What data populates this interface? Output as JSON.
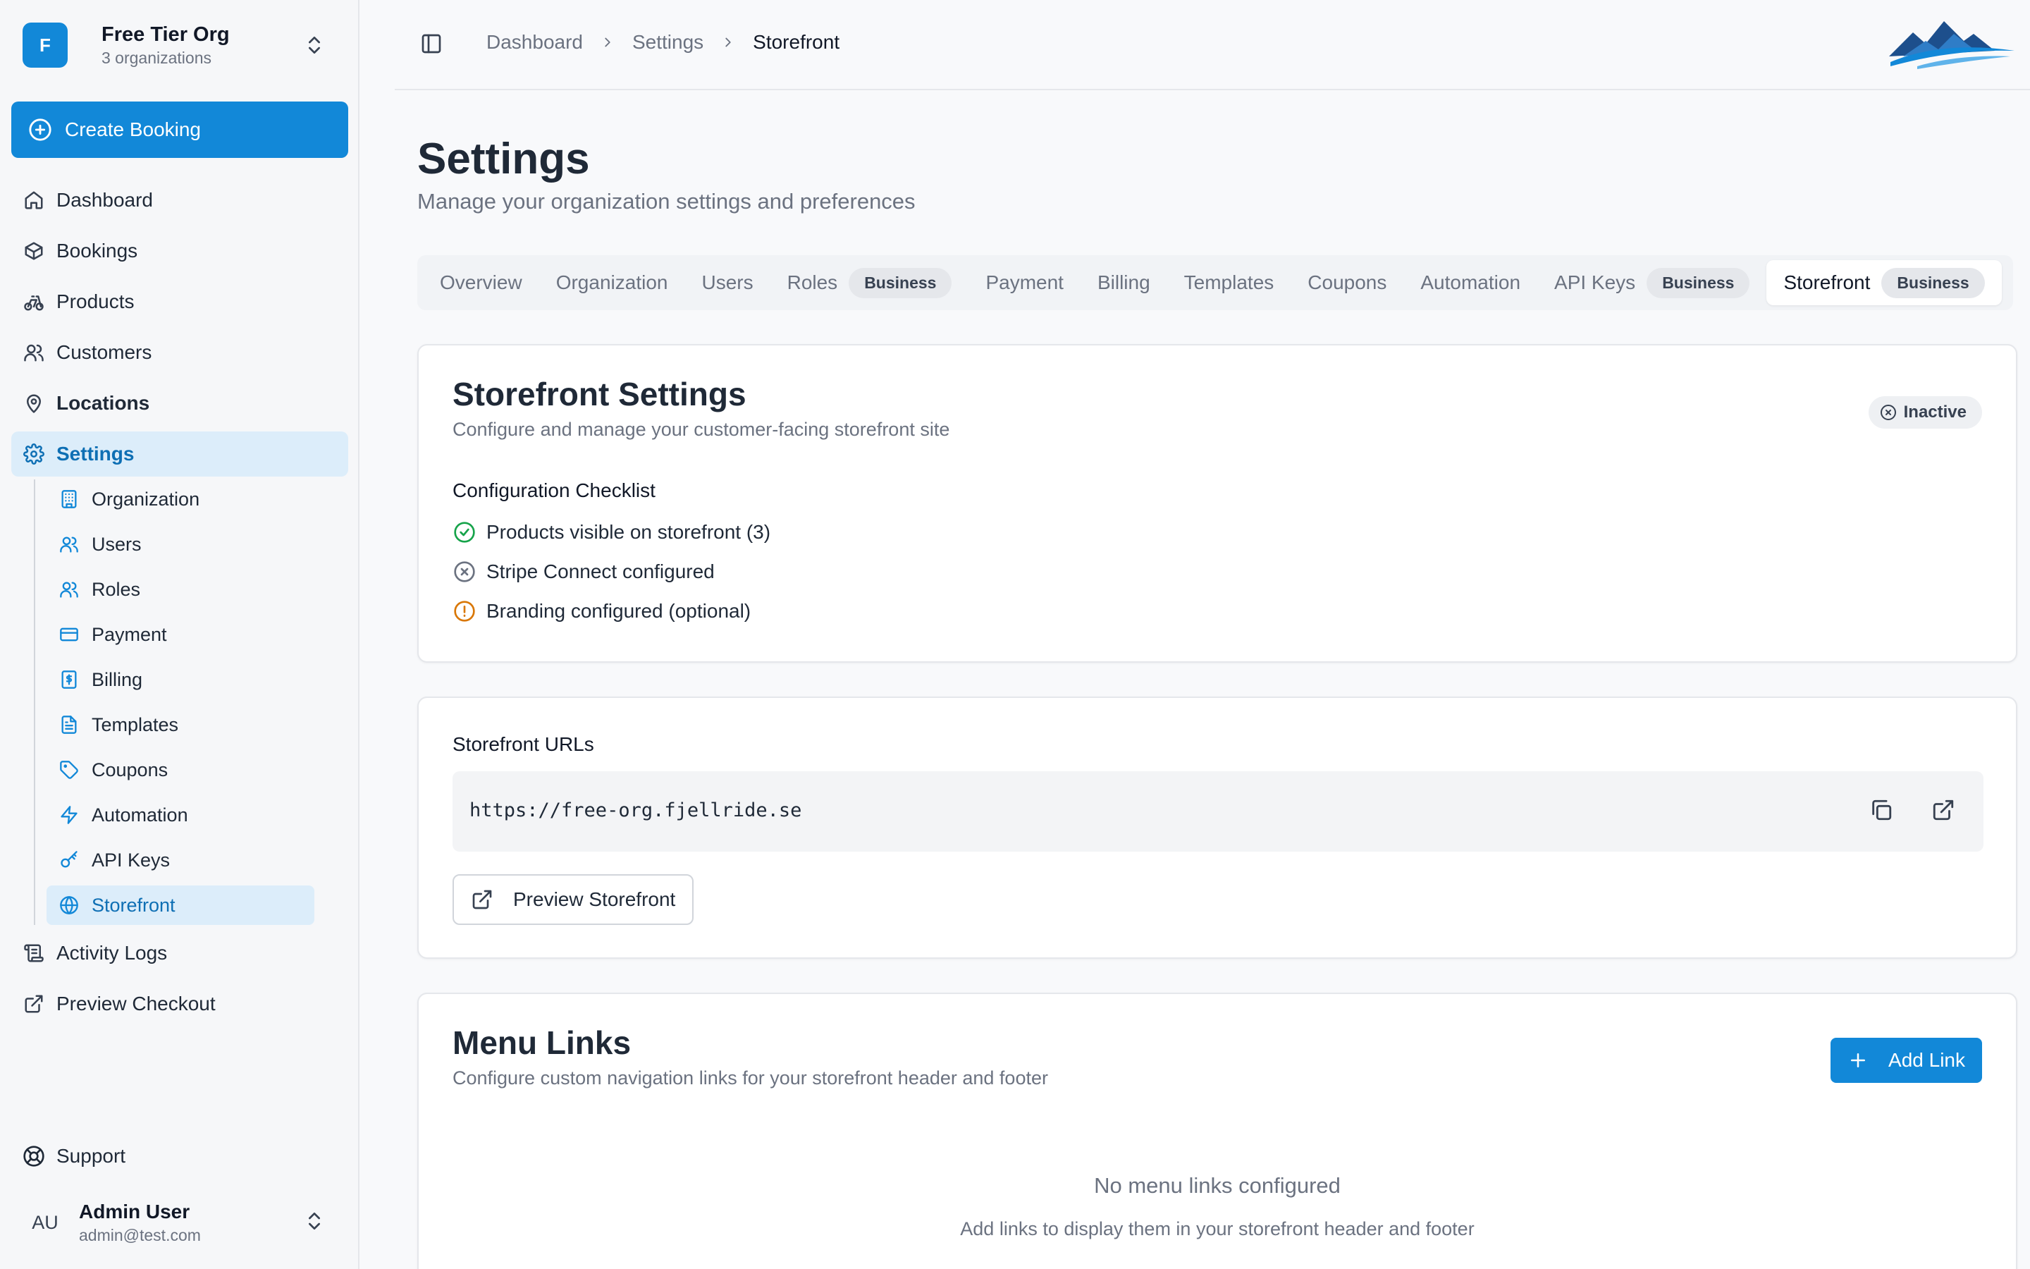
{
  "org": {
    "initial": "F",
    "name": "Free Tier Org",
    "count": "3 organizations"
  },
  "create_booking": "Create Booking",
  "nav": {
    "dashboard": "Dashboard",
    "bookings": "Bookings",
    "products": "Products",
    "customers": "Customers",
    "locations": "Locations",
    "settings": "Settings",
    "activity_logs": "Activity Logs",
    "preview_checkout": "Preview Checkout"
  },
  "settings_sub": {
    "organization": "Organization",
    "users": "Users",
    "roles": "Roles",
    "payment": "Payment",
    "billing": "Billing",
    "templates": "Templates",
    "coupons": "Coupons",
    "automation": "Automation",
    "api_keys": "API Keys",
    "storefront": "Storefront"
  },
  "support": "Support",
  "user": {
    "initials": "AU",
    "name": "Admin User",
    "email": "admin@test.com"
  },
  "breadcrumb": {
    "b0": "Dashboard",
    "b1": "Settings",
    "b2": "Storefront"
  },
  "page": {
    "title": "Settings",
    "subtitle": "Manage your organization settings and preferences"
  },
  "tabs": {
    "overview": "Overview",
    "organization": "Organization",
    "users": "Users",
    "roles": "Roles",
    "payment": "Payment",
    "billing": "Billing",
    "templates": "Templates",
    "coupons": "Coupons",
    "automation": "Automation",
    "api_keys": "API Keys",
    "storefront": "Storefront",
    "badge": "Business"
  },
  "storefront_settings": {
    "title": "Storefront Settings",
    "subtitle": "Configure and manage your customer-facing storefront site",
    "status": "Inactive",
    "checklist_title": "Configuration Checklist",
    "checklist": {
      "products": "Products visible on storefront (3)",
      "stripe": "Stripe Connect configured",
      "branding": "Branding configured (optional)"
    }
  },
  "urls": {
    "label": "Storefront URLs",
    "url": "https://free-org.fjellride.se",
    "preview_button": "Preview Storefront"
  },
  "menu_links": {
    "title": "Menu Links",
    "subtitle": "Configure custom navigation links for your storefront header and footer",
    "add_button": "Add Link",
    "empty_title": "No menu links configured",
    "empty_subtitle": "Add links to display them in your storefront header and footer"
  },
  "colors": {
    "primary": "#1288d8",
    "active_bg": "#dcedfa",
    "success": "#16a34a",
    "warning": "#d97706",
    "muted": "#6b7280"
  }
}
